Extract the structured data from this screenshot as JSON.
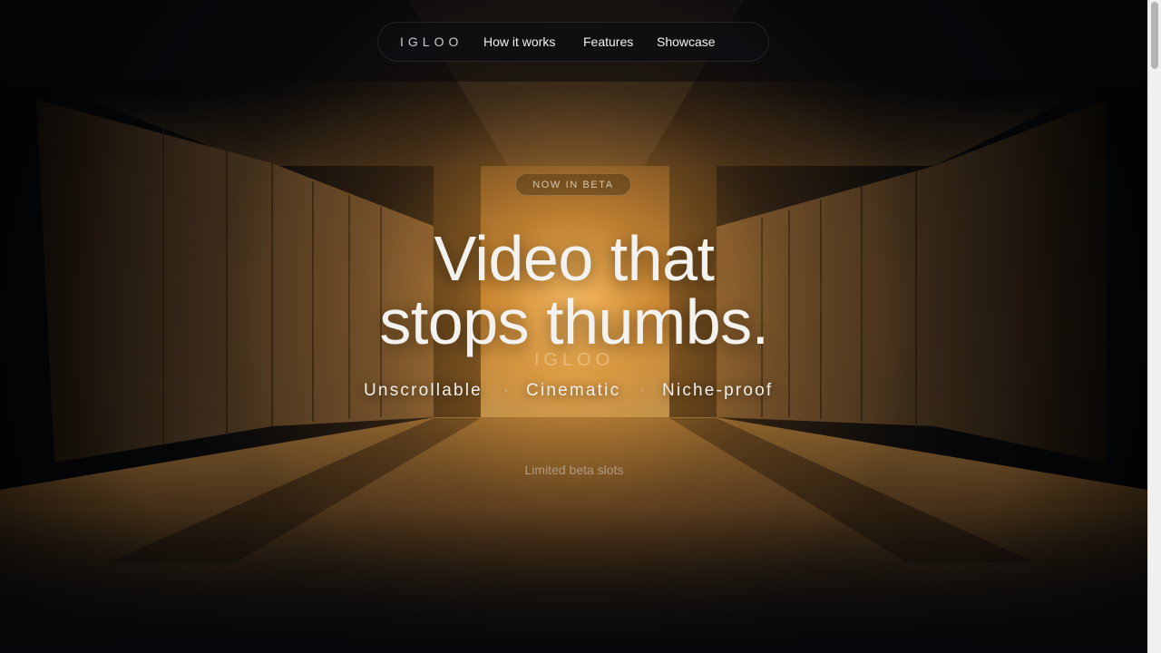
{
  "nav": {
    "brand": "IGLOO",
    "links": [
      {
        "label": "How it works"
      },
      {
        "label": "Features"
      },
      {
        "label": "Showcase"
      }
    ]
  },
  "hero": {
    "badge": "NOW IN BETA",
    "headline_line1": "Video that",
    "headline_line2": "stops thumbs.",
    "ghost_logo": "IGLOO",
    "taglines": [
      "Unscrollable",
      "Cinematic",
      "Niche-proof"
    ],
    "separator": "·",
    "slots_note": "Limited beta slots"
  },
  "colors": {
    "background": "#07080b",
    "glow": "#f2b35a",
    "concrete": "#7a5a35",
    "text": "#f4f2ef"
  }
}
